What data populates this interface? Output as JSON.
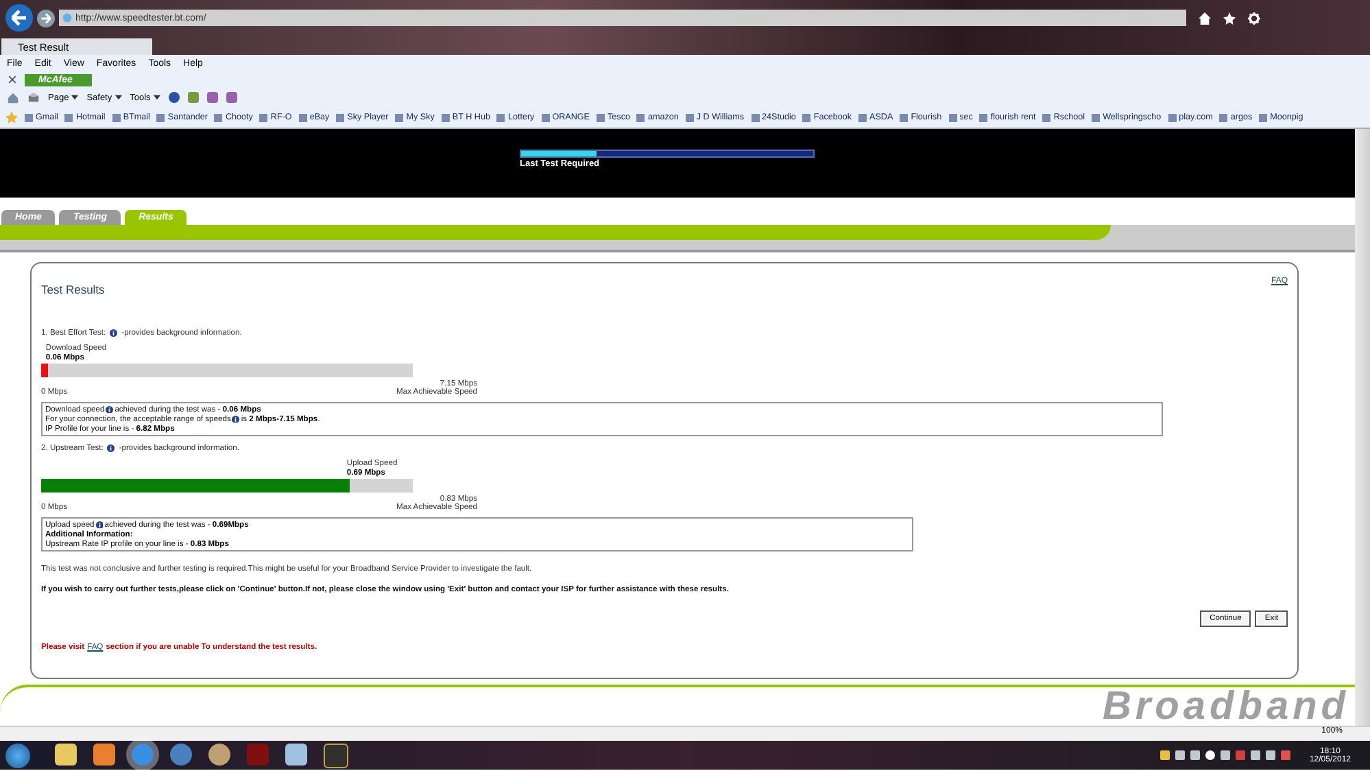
{
  "browser": {
    "url": "http://www.speedtester.bt.com/",
    "tab_title": "Test Result",
    "menu": [
      "File",
      "Edit",
      "View",
      "Favorites",
      "Tools",
      "Help"
    ],
    "addon": "McAfee",
    "commands": [
      "Page",
      "Safety",
      "Tools"
    ],
    "favorites": [
      "Gmail",
      "Hotmail",
      "BTmail",
      "Santander",
      "Chooty",
      "RF-O",
      "eBay",
      "Sky Player",
      "My Sky",
      "BT H Hub",
      "Lottery",
      "ORANGE",
      "Tesco",
      "amazon",
      "J D Williams",
      "24Studio",
      "Facebook",
      "ASDA",
      "Flourish",
      "sec",
      "flourish rent",
      "Rschool",
      "Wellspringscho",
      "play.com",
      "argos",
      "Moonpig"
    ],
    "zoom": "100%"
  },
  "page": {
    "progress": {
      "label": "Last Test Required",
      "level": 0.26
    },
    "tabs": [
      {
        "label": "Home",
        "selected": false
      },
      {
        "label": "Testing",
        "selected": false
      },
      {
        "label": "Results",
        "selected": true
      }
    ],
    "card": {
      "title": "Test Results",
      "faq": "FAQ",
      "tests": [
        {
          "heading": [
            "1. Best Effort Test:",
            "-provides background information."
          ],
          "meter": {
            "caption": "Download  Speed",
            "value": "0.06 Mbps",
            "level": 0.02,
            "color": "#ee1111",
            "min": "0 Mbps",
            "max": "7.15 Mbps",
            "max_label": "Max Achievable Speed"
          },
          "lines": [
            [
              "Download speed",
              "achieved during the test was - **0.06 Mbps**"
            ],
            [
              "For your connection, the acceptable range of speeds",
              "is **2 Mbps-7.15 Mbps**."
            ],
            [
              "IP Profile for your line is - **6.82 Mbps**"
            ]
          ]
        },
        {
          "heading": [
            "2. Upstream Test:",
            "-provides background information."
          ],
          "meter": {
            "caption": "Upload Speed",
            "value": "0.69 Mbps",
            "level": 0.83,
            "color": "#088008",
            "min": "0 Mbps",
            "max": "0.83 Mbps",
            "max_label": "Max Achievable Speed"
          },
          "lines": [
            [
              "Upload speed",
              "achieved during the test was - **0.69Mbps**"
            ],
            [
              "**Additional Information:**"
            ],
            [
              "Upstream Rate IP profile on your line is - **0.83 Mbps**"
            ]
          ]
        }
      ],
      "note": "This test was not conclusive and further testing is required.This might be useful for your Broadband Service Provider to investigate the fault.",
      "instruction": "If you wish to carry out further tests,please click on 'Continue' button.If not, please close the window using 'Exit' button and contact your ISP for further assistance with these results.",
      "buttons": [
        "Continue",
        "Exit"
      ],
      "help": [
        "Please visit",
        "FAQ",
        "section if you are unable To understand the test results."
      ]
    },
    "footer": "Broadband"
  },
  "taskbar": {
    "time": "18:10",
    "date": "12/05/2012"
  }
}
